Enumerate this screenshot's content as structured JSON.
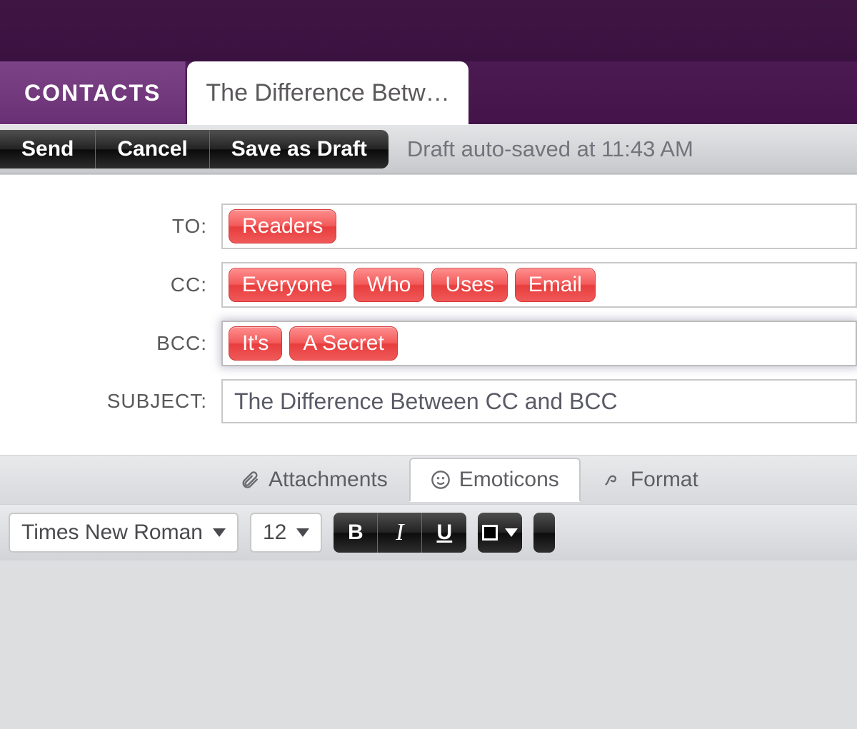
{
  "tabs": {
    "contacts": "CONTACTS",
    "compose": "The Difference Betw…"
  },
  "toolbar": {
    "send": "Send",
    "cancel": "Cancel",
    "saveDraft": "Save as Draft",
    "autosave": "Draft auto-saved at 11:43 AM"
  },
  "fields": {
    "to_label": "TO:",
    "cc_label": "CC:",
    "bcc_label": "BCC:",
    "subject_label": "SUBJECT:",
    "to_chips": [
      "Readers"
    ],
    "cc_chips": [
      "Everyone",
      "Who",
      "Uses",
      "Email"
    ],
    "bcc_chips": [
      "It's",
      "A Secret"
    ],
    "subject_value": "The Difference Between CC and BCC"
  },
  "subtabs": {
    "attachments": "Attachments",
    "emoticons": "Emoticons",
    "format": "Format"
  },
  "format": {
    "font": "Times New Roman",
    "size": "12",
    "bold": "B",
    "italic": "I",
    "underline": "U"
  }
}
